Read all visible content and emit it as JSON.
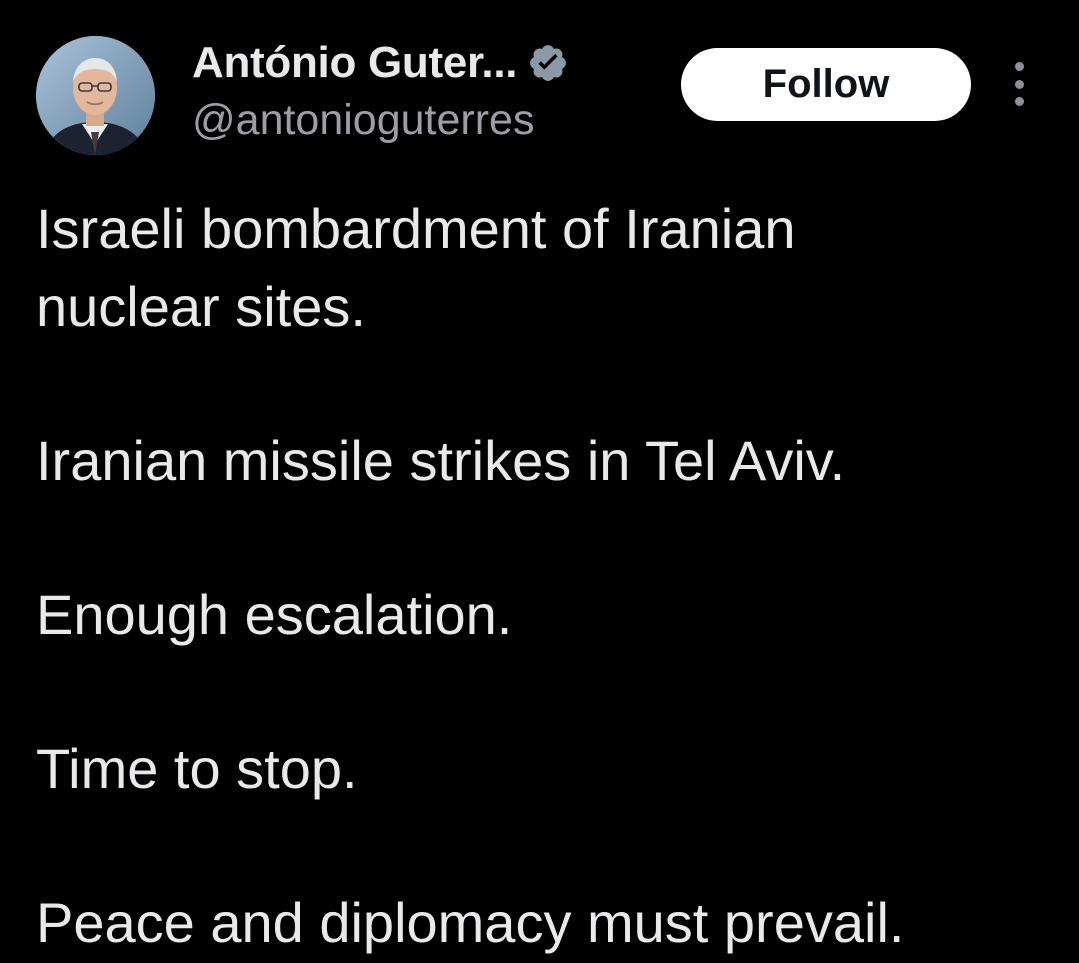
{
  "author": {
    "display_name": "António Guter...",
    "handle": "@antonioguterres",
    "verified": true,
    "avatar_icon": "profile-photo"
  },
  "actions": {
    "follow_label": "Follow",
    "more_icon": "more-vertical-icon"
  },
  "tweet": {
    "paragraphs": [
      [
        "Israeli bombardment of Iranian",
        "nuclear sites."
      ],
      [
        "Iranian missile strikes in Tel Aviv."
      ],
      [
        "Enough escalation."
      ],
      [
        "Time to stop."
      ],
      [
        "Peace and diplomacy must prevail."
      ]
    ]
  },
  "colors": {
    "background": "#000000",
    "text": "#e7e9ea",
    "secondary_text": "#9a9fa4",
    "follow_bg": "#ffffff",
    "follow_text": "#0f1419",
    "verified_badge": "#8b98a5"
  }
}
